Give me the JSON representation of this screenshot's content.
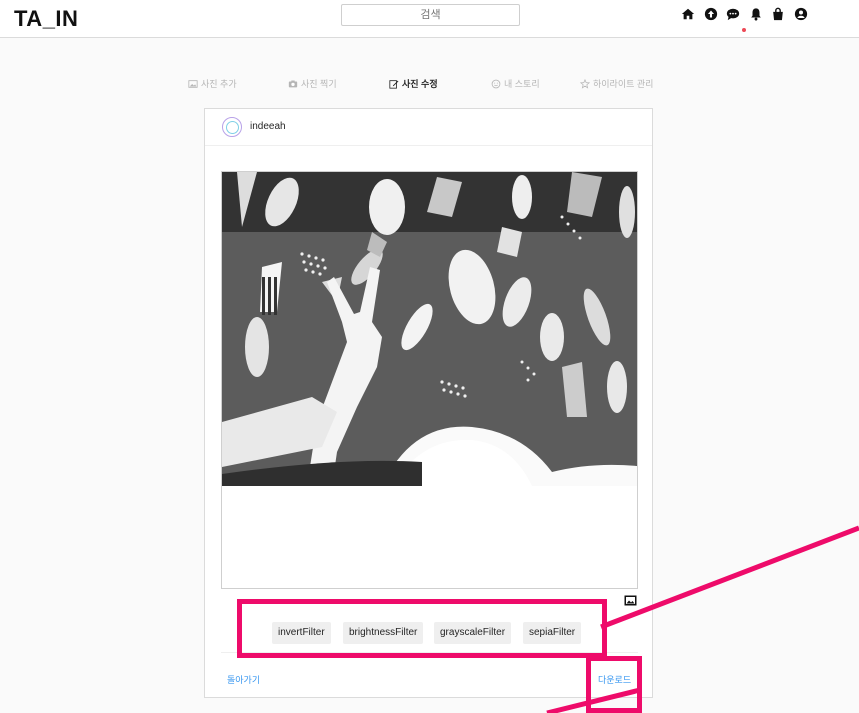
{
  "header": {
    "logo": "TA_IN",
    "search_placeholder": "검색",
    "icons": [
      "home-icon",
      "upload-icon",
      "chat-icon",
      "bell-icon",
      "bag-icon",
      "profile-icon"
    ]
  },
  "tabs": [
    {
      "label": "사진 추가",
      "icon": "image-icon"
    },
    {
      "label": "사진 찍기",
      "icon": "camera-icon"
    },
    {
      "label": "사진 수정",
      "icon": "edit-icon"
    },
    {
      "label": "내 스토리",
      "icon": "smile-icon"
    },
    {
      "label": "하이라이트 관리",
      "icon": "star-icon"
    }
  ],
  "post": {
    "username": "indeeah"
  },
  "filters": [
    "invertFilter",
    "brightnessFilter",
    "grayscaleFilter",
    "sepiaFilter"
  ],
  "footer": {
    "back": "돌아가기",
    "download": "다운로드"
  },
  "colors": {
    "highlight": "#ee0b6a",
    "link": "#3897f0",
    "notification_dot": "#ed4956"
  }
}
